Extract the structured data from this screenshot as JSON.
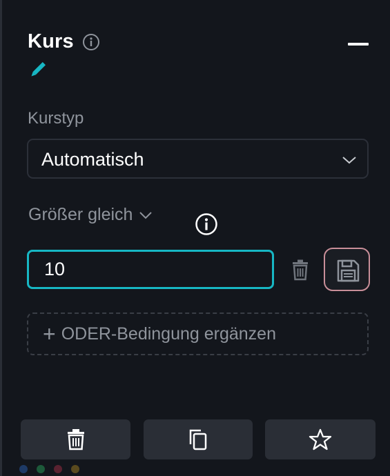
{
  "section": {
    "title": "Kurs",
    "info_icon": "info-icon",
    "collapse_icon": "minus-icon",
    "edit_icon": "pencil-icon"
  },
  "course_type": {
    "label": "Kurstyp",
    "value": "Automatisch",
    "chevron_icon": "chevron-down-icon"
  },
  "condition": {
    "operator": "Größer gleich",
    "operator_icon": "chevron-down-icon",
    "info_icon": "info-icon",
    "value": "10",
    "delete_icon": "trash-icon",
    "save_icon": "floppy-disk-icon"
  },
  "or_condition": {
    "plus": "+",
    "label": "ODER-Bedingung ergänzen"
  },
  "footer": {
    "buttons": [
      {
        "icon": "trash-icon"
      },
      {
        "icon": "copy-icon"
      },
      {
        "icon": "star-icon"
      }
    ]
  },
  "colors": {
    "background": "#13161c",
    "accent": "#17b7c4",
    "save_border": "#c98f99",
    "muted_text": "#8f949c",
    "dots": [
      "#1e3a66",
      "#1d5a3a",
      "#5a2230",
      "#5a4a1e"
    ]
  }
}
